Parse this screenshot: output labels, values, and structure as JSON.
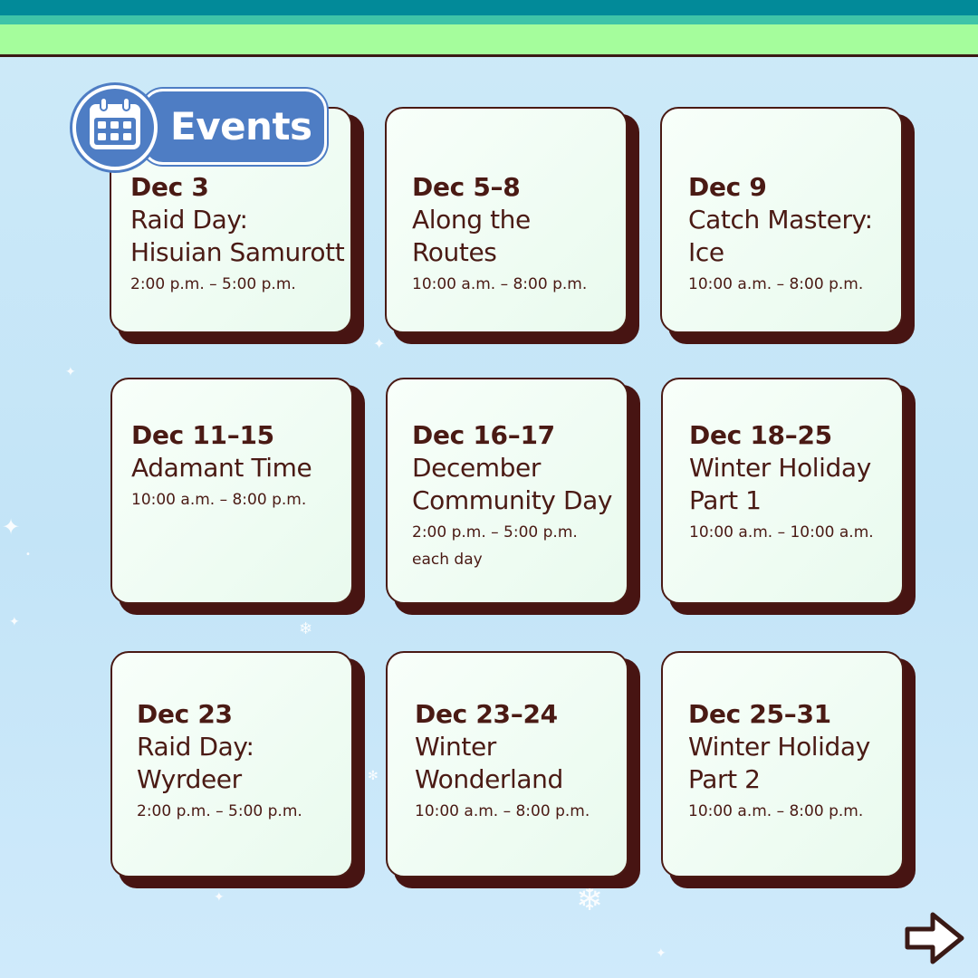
{
  "header": {
    "title": "Events",
    "icon": "calendar-icon"
  },
  "colors": {
    "band_top": "#028a99",
    "band_lime": "#a5fd9c",
    "badge": "#4e7dc4",
    "card_fill": "#f1fdf4",
    "card_shadow": "#471412",
    "text": "#4a1a14"
  },
  "events": [
    {
      "date": "Dec 3",
      "title_lines": [
        "Raid Day:",
        "Hisuian Samurott"
      ],
      "time": "2:00 p.m. – 5:00 p.m.",
      "note": ""
    },
    {
      "date": "Dec 5–8",
      "title_lines": [
        "Along the",
        "Routes"
      ],
      "time": "10:00 a.m. – 8:00 p.m.",
      "note": ""
    },
    {
      "date": "Dec 9",
      "title_lines": [
        "Catch Mastery:",
        "Ice"
      ],
      "time": "10:00 a.m. – 8:00 p.m.",
      "note": ""
    },
    {
      "date": "Dec 11–15",
      "title_lines": [
        "Adamant Time"
      ],
      "time": "10:00 a.m. – 8:00 p.m.",
      "note": ""
    },
    {
      "date": "Dec 16–17",
      "title_lines": [
        "December",
        "Community Day"
      ],
      "time": "2:00 p.m. – 5:00 p.m.",
      "note": "each day"
    },
    {
      "date": "Dec 18–25",
      "title_lines": [
        "Winter Holiday",
        "Part 1"
      ],
      "time": "10:00 a.m. – 10:00 a.m.",
      "note": ""
    },
    {
      "date": "Dec 23",
      "title_lines": [
        "Raid Day:",
        "Wyrdeer"
      ],
      "time": "2:00 p.m. – 5:00 p.m.",
      "note": ""
    },
    {
      "date": "Dec 23–24",
      "title_lines": [
        "Winter",
        "Wonderland"
      ],
      "time": "10:00 a.m. – 8:00 p.m.",
      "note": ""
    },
    {
      "date": "Dec 25–31",
      "title_lines": [
        "Winter Holiday",
        "Part 2"
      ],
      "time": "10:00 a.m. – 8:00 p.m.",
      "note": ""
    }
  ],
  "navigation": {
    "next_icon": "arrow-right-icon"
  }
}
